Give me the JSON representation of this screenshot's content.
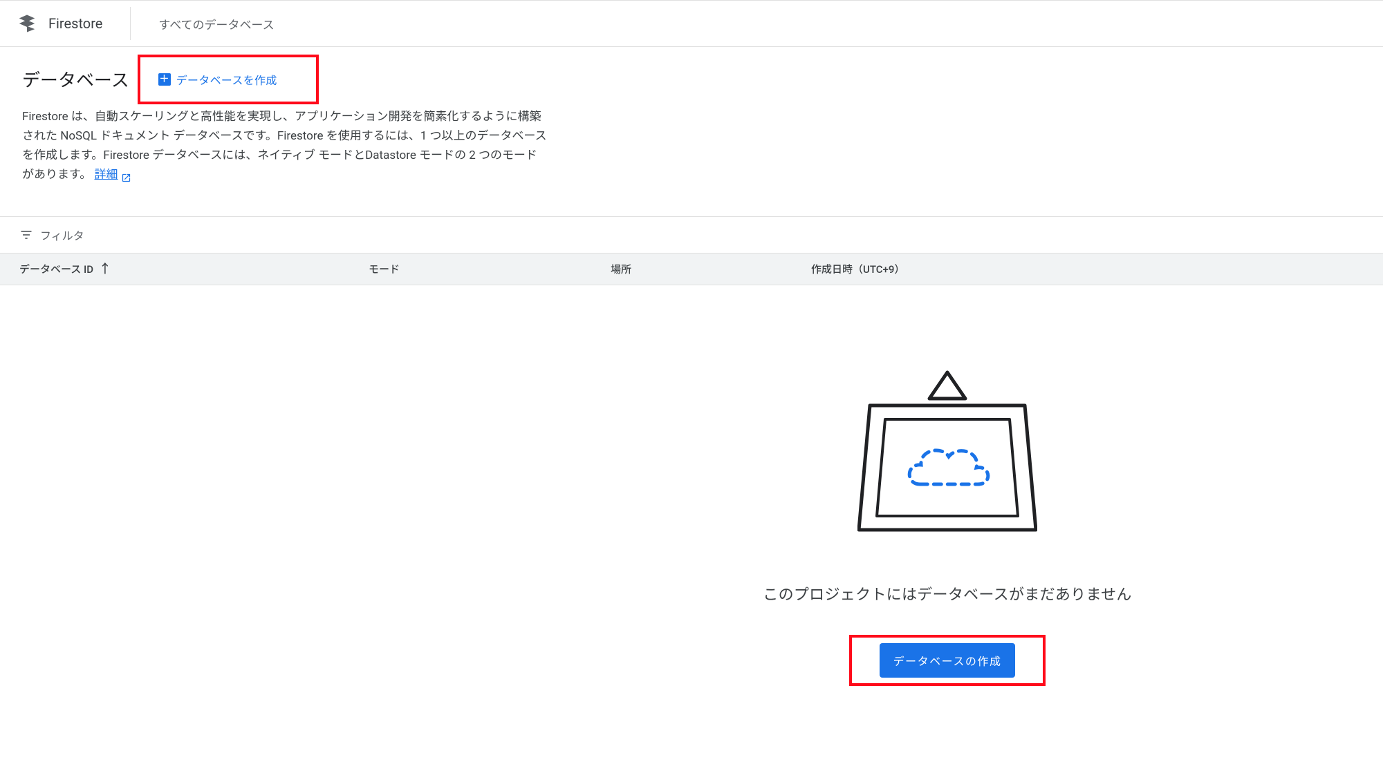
{
  "header": {
    "product_name": "Firestore",
    "breadcrumb": "すべてのデータベース"
  },
  "page": {
    "title": "データベース",
    "create_button_top": "データベースを作成",
    "description": "Firestore は、自動スケーリングと高性能を実現し、アプリケーション開発を簡素化するように構築された NoSQL ドキュメント データベースです。Firestore を使用するには、1 つ以上のデータベースを作成します。Firestore データベースには、ネイティブ モードとDatastore モードの 2 つのモードがあります。",
    "details_link": "詳細"
  },
  "filter": {
    "label": "フィルタ"
  },
  "table": {
    "columns": {
      "id": "データベース ID",
      "mode": "モード",
      "location": "場所",
      "created": "作成日時（UTC+9）"
    }
  },
  "empty_state": {
    "message": "このプロジェクトにはデータベースがまだありません",
    "create_button": "データベースの作成"
  },
  "colors": {
    "primary": "#1a73e8",
    "highlight": "#ff0a1a"
  }
}
